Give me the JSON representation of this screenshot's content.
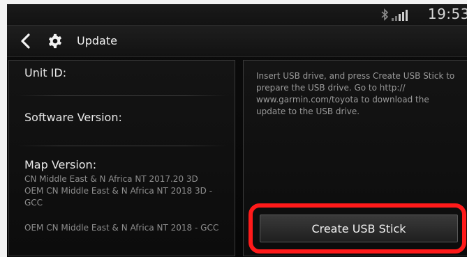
{
  "status_bar": {
    "time": "19:53",
    "bluetooth_icon": "bluetooth-icon",
    "signal_icon": "signal-bars-icon"
  },
  "header": {
    "back_icon": "chevron-left-icon",
    "settings_icon": "gear-icon",
    "title": "Update"
  },
  "left_panel": {
    "unit_id_label": "Unit ID:",
    "software_version_label": "Software Version:",
    "map_version_label": "Map Version:",
    "map_versions": [
      "CN Middle East & N Africa NT 2017.20 3D",
      "OEM CN Middle East & N Africa NT 2018 3D - GCC",
      "OEM CN Middle East & N Africa NT 2018 - GCC"
    ]
  },
  "right_panel": {
    "instructions": "Insert USB drive, and press Create USB Stick to prepare the USB drive. Go to http:// www.garmin.com/toyota to download the update to the USB drive.",
    "create_usb_button": "Create USB Stick"
  },
  "colors": {
    "highlight": "#ff1a1a",
    "background": "#0b0b0b",
    "frame": "#f2f2f2"
  }
}
